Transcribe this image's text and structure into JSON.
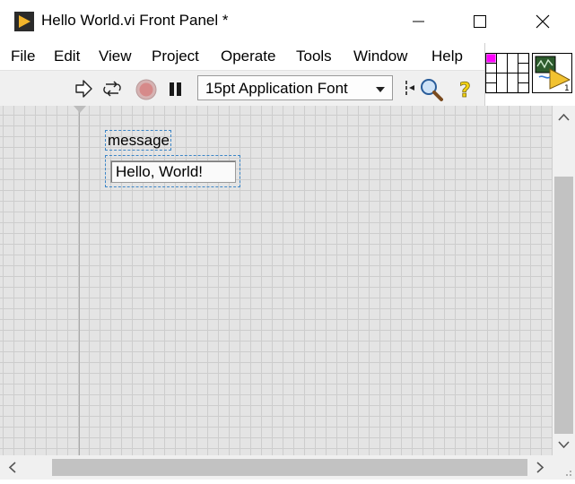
{
  "window": {
    "title": "Hello World.vi Front Panel *"
  },
  "menu": {
    "items": [
      {
        "label": "File"
      },
      {
        "label": "Edit"
      },
      {
        "label": "View"
      },
      {
        "label": "Project"
      },
      {
        "label": "Operate"
      },
      {
        "label": "Tools"
      },
      {
        "label": "Window"
      },
      {
        "label": "Help"
      }
    ]
  },
  "toolbar": {
    "font_select_value": "15pt Application Font",
    "icons": [
      "run-arrow-icon",
      "run-continuously-icon",
      "abort-icon",
      "pause-icon",
      "text-settings-icon",
      "align-objects-icon",
      "search-icon",
      "context-help-icon"
    ]
  },
  "panel": {
    "string_control": {
      "label": "message",
      "value": "Hello, World!"
    }
  },
  "colors": {
    "panel_bg": "#e4e4e4",
    "grid_line": "#cdcdcd",
    "selection_dash": "#3d86c6",
    "connector_terminal": "#ff00ff",
    "icon_run_orange": "#f2a32b"
  }
}
